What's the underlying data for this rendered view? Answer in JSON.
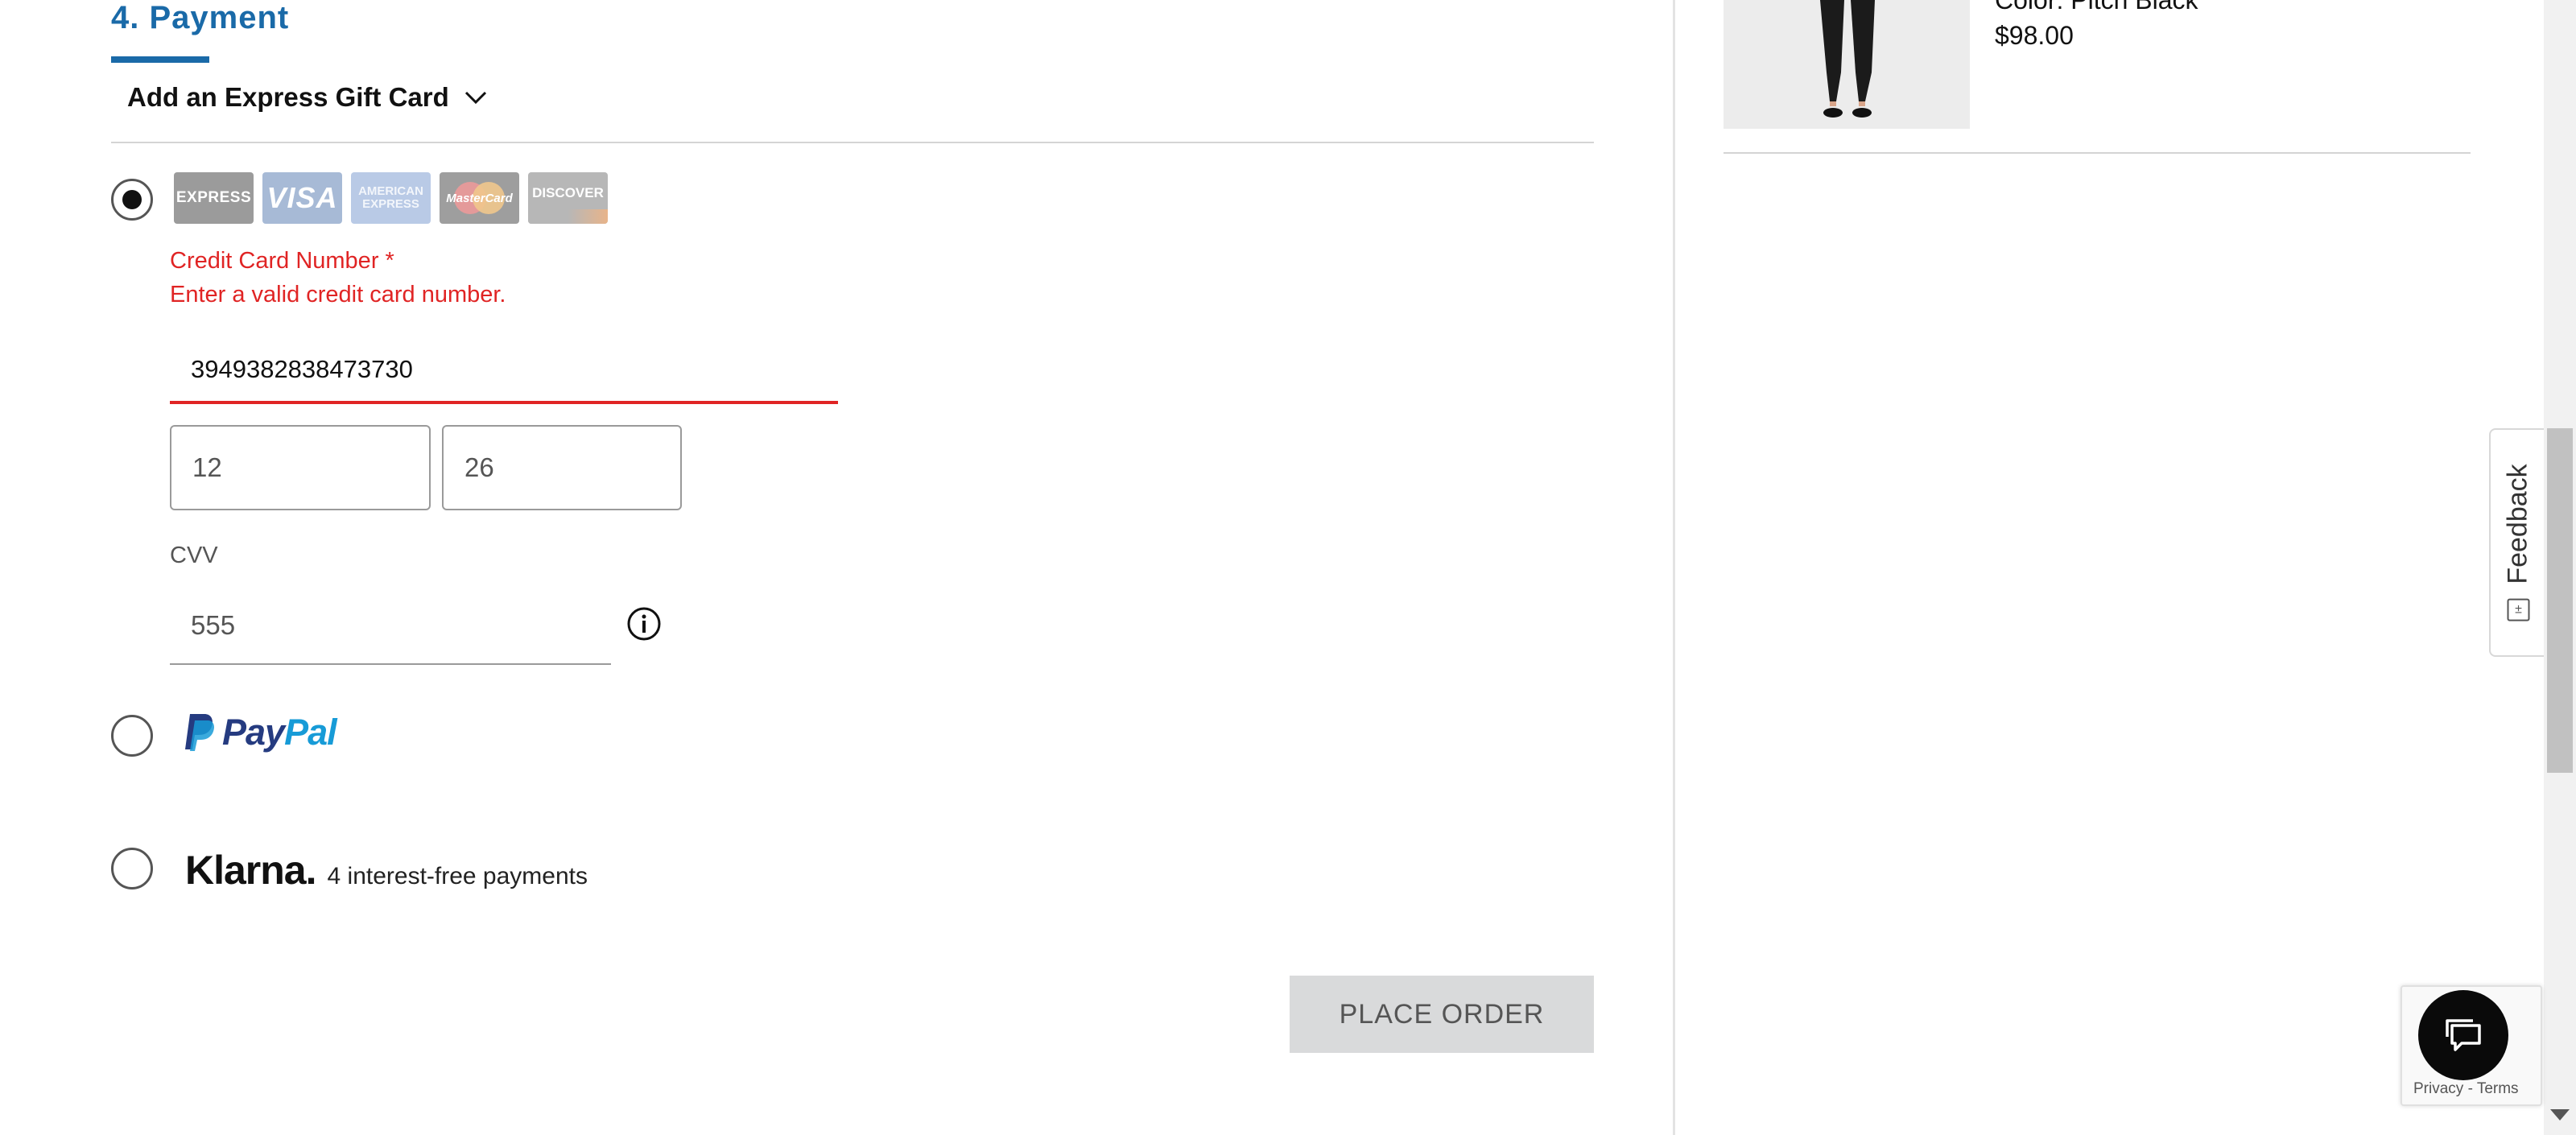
{
  "section": {
    "title": "4. Payment"
  },
  "gift_card": {
    "label": "Add an Express Gift Card"
  },
  "card_logos": {
    "express": "EXPRESS",
    "visa": "VISA",
    "amex_line1": "AMERICAN",
    "amex_line2": "EXPRESS",
    "mastercard": "MasterCard",
    "discover": "DISCOVER"
  },
  "credit_card": {
    "label": "Credit Card Number *",
    "error": "Enter a valid credit card number.",
    "number": "3949382838473730",
    "exp_month": "12",
    "exp_year": "26",
    "cvv_label": "CVV",
    "cvv": "555"
  },
  "paypal": {
    "brand_part1": "Pay",
    "brand_part2": "Pal"
  },
  "klarna": {
    "brand": "Klarna.",
    "text": "4 interest-free payments"
  },
  "place_order": {
    "label": "PLACE ORDER"
  },
  "product": {
    "color": "Color: Pitch Black",
    "price": "$98.00"
  },
  "feedback": {
    "label": "Feedback"
  },
  "recaptcha": {
    "text": "Privacy - Terms"
  },
  "colors": {
    "accent": "#1a6aa8",
    "error": "#e02424",
    "button_bg": "#d9dadb"
  }
}
